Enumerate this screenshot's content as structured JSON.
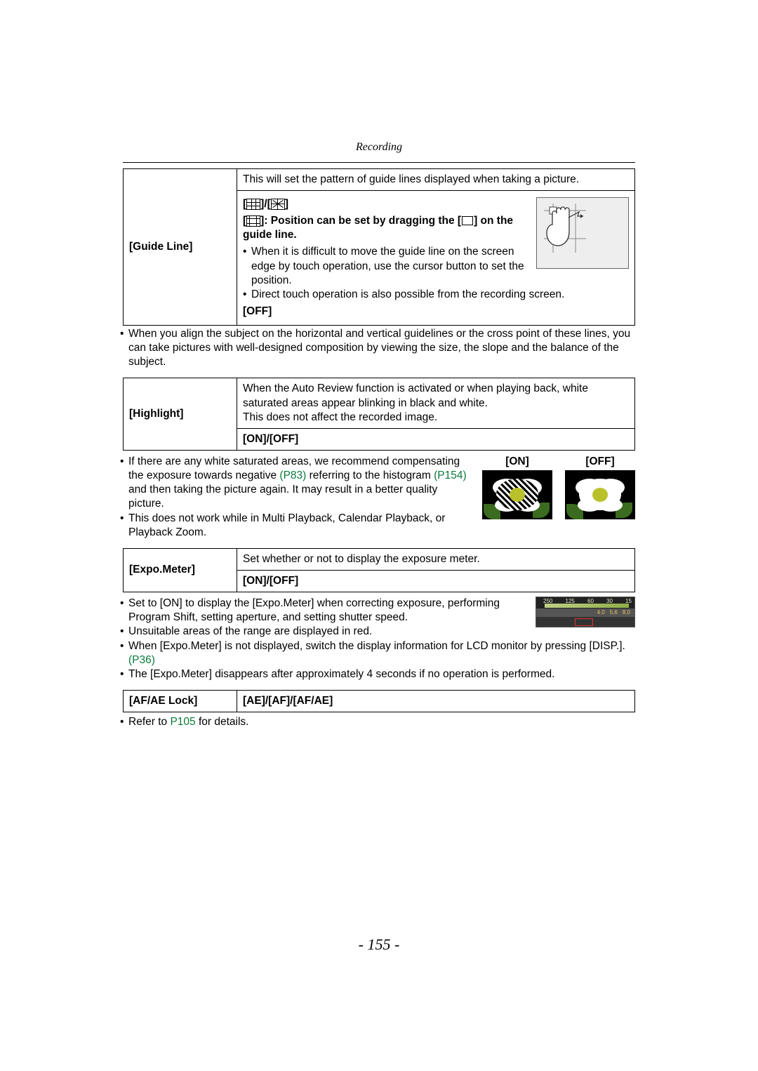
{
  "header": {
    "section": "Recording"
  },
  "guideLine": {
    "label": "[Guide Line]",
    "intro": "This will set the pattern of guide lines displayed when taking a picture.",
    "iconsRow": {
      "open": "[",
      "sep": "]/[",
      "close": "]"
    },
    "positionBold1": "]: Position can be set by dragging the [",
    "positionBold2": "] on the guide line.",
    "sub1": "When it is difficult to move the guide line on the screen edge by touch operation, use the cursor button to set the position.",
    "sub2": "Direct touch operation is also possible from the recording screen.",
    "off": "[OFF]",
    "note": "When you align the subject on the horizontal and vertical guidelines or the cross point of these lines, you can take pictures with well-designed composition by viewing the size, the slope and the balance of the subject."
  },
  "highlight": {
    "label": "[Highlight]",
    "desc": "When the Auto Review function is activated or when playing back, white saturated areas appear blinking in black and white.\nThis does not affect the recorded image.",
    "options": "[ON]/[OFF]",
    "imgLabels": {
      "on": "[ON]",
      "off": "[OFF]"
    },
    "note1a": "If there are any white saturated areas, we recommend compensating the exposure towards negative ",
    "linkP83": "(P83)",
    "note1b": " referring to the histogram ",
    "linkP154": "(P154)",
    "note1c": " and then taking the picture again. It may result in a better quality picture.",
    "note2": "This does not work while in Multi Playback, Calendar Playback, or Playback Zoom."
  },
  "expoMeter": {
    "label": "[Expo.Meter]",
    "desc": "Set whether or not to display the exposure meter.",
    "options": "[ON]/[OFF]",
    "scaleTop": [
      "250",
      "125",
      "60",
      "30",
      "15"
    ],
    "scaleBot": [
      "4.0",
      "5.6",
      "8.0"
    ],
    "note1": "Set to [ON] to display the [Expo.Meter] when correcting exposure, performing Program Shift, setting aperture, and setting shutter speed.",
    "note2": "Unsuitable areas of the range are displayed in red.",
    "note3a": "When [Expo.Meter] is not displayed, switch the display information for LCD monitor by pressing [DISP.]. ",
    "linkP36": "(P36)",
    "note4": "The [Expo.Meter] disappears after approximately 4 seconds if no operation is performed."
  },
  "afae": {
    "label": "[AF/AE Lock]",
    "options": "[AE]/[AF]/[AF/AE]",
    "note_a": "Refer to ",
    "linkP105": "P105",
    "note_b": " for details."
  },
  "pageNumber": "- 155 -"
}
